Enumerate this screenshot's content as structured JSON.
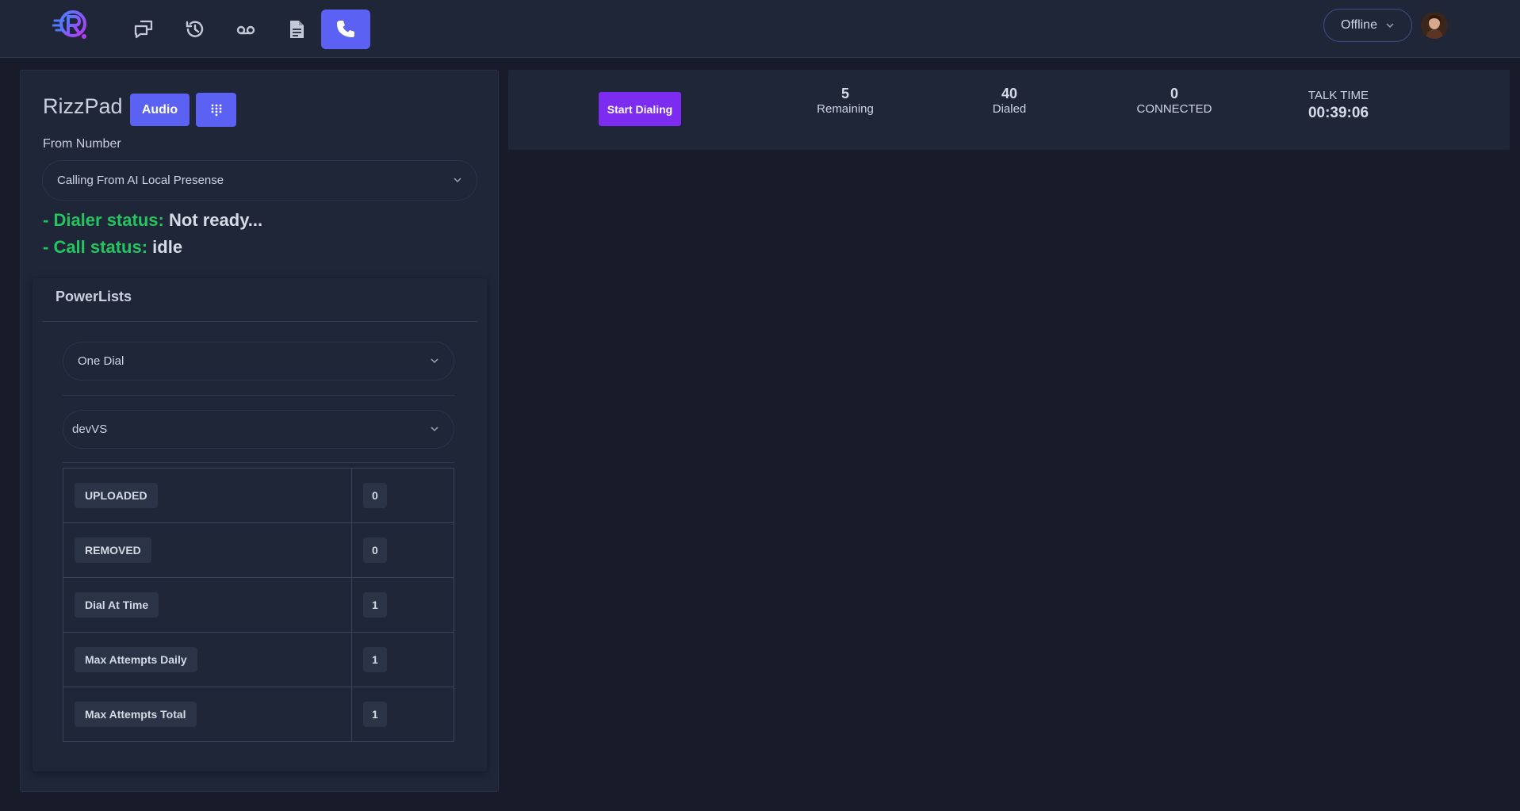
{
  "nav": {
    "status_value": "Offline"
  },
  "dialer": {
    "title": "RizzPad",
    "audio_label": "Audio",
    "from_label": "From Number",
    "from_value": "Calling From AI Local Presense",
    "dialer_status_label": "- Dialer status:",
    "dialer_status_value": "Not ready...",
    "call_status_label": "- Call status:",
    "call_status_value": "idle"
  },
  "powerlists": {
    "title": "PowerLists",
    "mode_value": "One Dial",
    "list_value": "devVS",
    "rows": [
      {
        "label": "UPLOADED",
        "value": "0"
      },
      {
        "label": "REMOVED",
        "value": "0"
      },
      {
        "label": "Dial At Time",
        "value": "1"
      },
      {
        "label": "Max Attempts Daily",
        "value": "1"
      },
      {
        "label": "Max Attempts Total",
        "value": "1"
      }
    ]
  },
  "stats": {
    "start_label": "Start Dialing",
    "remaining_value": "5",
    "remaining_label": "Remaining",
    "dialed_value": "40",
    "dialed_label": "Dialed",
    "connected_value": "0",
    "connected_label": "CONNECTED",
    "talk_label": "TALK TIME",
    "talk_value": "00:39:06"
  },
  "colors": {
    "accent": "#5b62f3",
    "start_button": "#7c2cf0",
    "status_green": "#22c55e",
    "background": "#171b2a",
    "panel": "#1e2638"
  },
  "icons": [
    "app-logo",
    "messages-icon",
    "history-icon",
    "voicemail-icon",
    "document-icon",
    "phone-icon",
    "chevron-down-icon",
    "keypad-icon"
  ]
}
